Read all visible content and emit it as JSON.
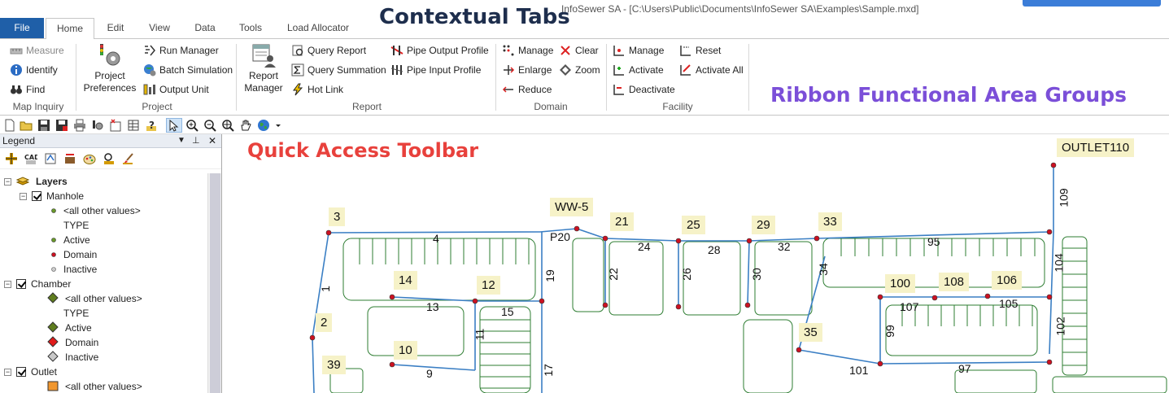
{
  "window": {
    "title": "InfoSewer SA - [C:\\Users\\Public\\Documents\\InfoSewer SA\\Examples\\Sample.mxd]"
  },
  "tabs": [
    "File",
    "Home",
    "Edit",
    "View",
    "Data",
    "Tools",
    "Load Allocator"
  ],
  "active_tab": "Home",
  "callouts": {
    "contextual_tabs": "Contextual Tabs",
    "ribbon_groups": "Ribbon Functional Area Groups",
    "quick_access": "Quick Access Toolbar"
  },
  "colors": {
    "file_tab": "#1f5fa8",
    "callout_dark": "#1e2e4d",
    "callout_purple": "#7b4fd8",
    "callout_red": "#e8413c",
    "pipe_blue": "#3b7fc4",
    "parcel_green": "#2e7d32",
    "node_red": "#cc1122",
    "tag_yellow": "#f6f2c8"
  },
  "ribbon": {
    "map_inquiry": {
      "label": "Map Inquiry",
      "items": [
        "Measure",
        "Identify",
        "Find"
      ]
    },
    "project": {
      "label": "Project",
      "big": "Project Preferences",
      "items": [
        "Run Manager",
        "Batch Simulation",
        "Output Unit"
      ]
    },
    "report": {
      "label": "Report",
      "big": "Report Manager",
      "items": [
        "Query Report",
        "Query Summation",
        "Hot Link",
        "Pipe Output Profile",
        "Pipe Input Profile"
      ]
    },
    "domain": {
      "label": "Domain",
      "items": [
        "Manage",
        "Enlarge",
        "Reduce",
        "Clear",
        "Zoom"
      ]
    },
    "facility": {
      "label": "Facility",
      "items": [
        "Manage",
        "Activate",
        "Deactivate",
        "Reset",
        "Activate All"
      ]
    }
  },
  "legend": {
    "title": "Legend",
    "tree": [
      {
        "kind": "root",
        "label": "Layers"
      },
      {
        "kind": "layer",
        "label": "Manhole"
      },
      {
        "kind": "class",
        "label": "<all other values>",
        "symbol": "dot-green"
      },
      {
        "kind": "field",
        "label": "TYPE"
      },
      {
        "kind": "class",
        "label": "Active",
        "symbol": "dot-green"
      },
      {
        "kind": "class",
        "label": "Domain",
        "symbol": "dot-red"
      },
      {
        "kind": "class",
        "label": "Inactive",
        "symbol": "dot-grey"
      },
      {
        "kind": "layer",
        "label": "Chamber"
      },
      {
        "kind": "class",
        "label": "<all other values>",
        "symbol": "diamond-green"
      },
      {
        "kind": "field",
        "label": "TYPE"
      },
      {
        "kind": "class",
        "label": "Active",
        "symbol": "diamond-green"
      },
      {
        "kind": "class",
        "label": "Domain",
        "symbol": "diamond-red"
      },
      {
        "kind": "class",
        "label": "Inactive",
        "symbol": "diamond-grey"
      },
      {
        "kind": "layer",
        "label": "Outlet"
      },
      {
        "kind": "class",
        "label": "<all other values>",
        "symbol": "square-orange"
      }
    ]
  },
  "map": {
    "node_tags": [
      "OUTLET110",
      "WW-5",
      "3",
      "21",
      "25",
      "29",
      "33",
      "14",
      "12",
      "100",
      "108",
      "106",
      "2",
      "35",
      "10",
      "39"
    ],
    "pipe_labels": [
      "109",
      "P20",
      "4",
      "24",
      "28",
      "32",
      "95",
      "1",
      "19",
      "22",
      "26",
      "30",
      "34",
      "104",
      "13",
      "15",
      "107",
      "105",
      "11",
      "99",
      "102",
      "17",
      "9",
      "101",
      "97"
    ]
  }
}
